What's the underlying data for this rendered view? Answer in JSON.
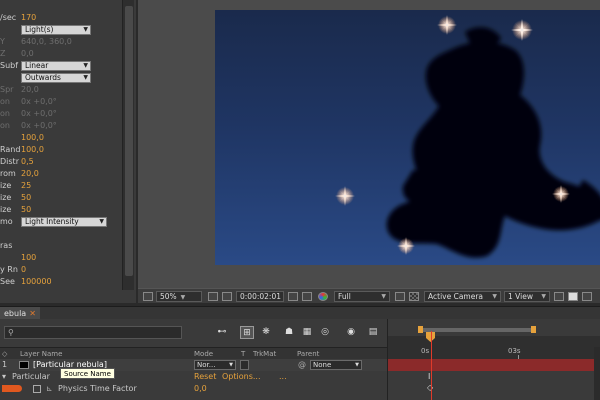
{
  "effect_controls": {
    "rows": [
      {
        "label": "/sec",
        "value": "170",
        "dim": false
      },
      {
        "label": "",
        "value": "Light(s)",
        "type": "select"
      },
      {
        "label": "Y",
        "value": "640,0, 360,0",
        "dim": true
      },
      {
        "label": "Z",
        "value": "0,0",
        "dim": true
      },
      {
        "label": "Subf",
        "value": "Linear",
        "type": "select"
      },
      {
        "label": "",
        "value": "Outwards",
        "type": "select"
      },
      {
        "label": "Spr",
        "value": "20,0",
        "dim": true
      },
      {
        "label": "on",
        "value": "0x +0,0°",
        "dim": true
      },
      {
        "label": "on",
        "value": "0x +0,0°",
        "dim": true
      },
      {
        "label": "on",
        "value": "0x +0,0°",
        "dim": true
      },
      {
        "label": "",
        "value": "100,0",
        "dim": false
      },
      {
        "label": "Rand",
        "value": "100,0",
        "dim": false
      },
      {
        "label": "Distr",
        "value": "0,5",
        "dim": false
      },
      {
        "label": "rom",
        "value": "20,0",
        "dim": false
      },
      {
        "label": "ize",
        "value": "25",
        "dim": false
      },
      {
        "label": "ize",
        "value": "50",
        "dim": false
      },
      {
        "label": "ize",
        "value": "50",
        "dim": false
      },
      {
        "label": "mo",
        "value": "Light Intensity",
        "type": "select"
      },
      {
        "label": "",
        "value": "",
        "dim": false
      },
      {
        "label": "ras",
        "value": "",
        "dim": false
      },
      {
        "label": "",
        "value": "100",
        "dim": false
      },
      {
        "label": "y Rn",
        "value": "0",
        "dim": false
      },
      {
        "label": "See",
        "value": "100000",
        "dim": false
      }
    ]
  },
  "viewer_bar": {
    "zoom": "50%",
    "timecode": "0:00:02:01",
    "resolution": "Full",
    "camera": "Active Camera",
    "views": "1 View"
  },
  "timeline": {
    "tab_label": "ebula",
    "search_placeholder": "",
    "headers": {
      "layer_name": "Layer Name",
      "mode": "Mode",
      "t": "T",
      "trkmat": "TrkMat",
      "parent": "Parent"
    },
    "layer": {
      "name": "[Particular nebula]",
      "mode": "Nor...",
      "parent": "None"
    },
    "effect_row": {
      "name": "Particular",
      "reset": "Reset",
      "options": "Options...",
      "dots": "..."
    },
    "property_row": {
      "name": "Physics Time Factor",
      "value": "0,0"
    },
    "tooltip": "Source Name",
    "ruler": {
      "start": "0s",
      "mark": "03s"
    }
  },
  "colors": {
    "accent": "#e6a23c",
    "layer_bar": "#8b2a2a",
    "playhead": "#e03a2a",
    "sky_top": "#1a2a4c",
    "sky_bottom": "#2a4a86"
  }
}
